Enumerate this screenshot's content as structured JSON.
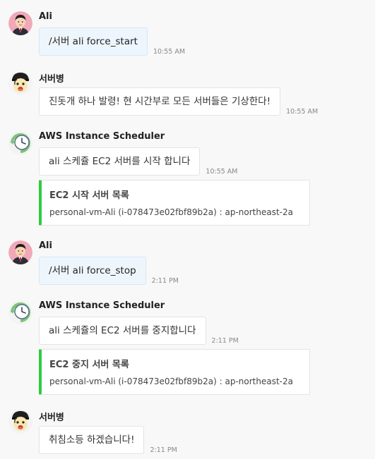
{
  "colors": {
    "background": "#f8f8f8",
    "user_bubble": "#eef6fd",
    "bot_bubble": "#ffffff",
    "attachment_accent": "#2ecc40"
  },
  "messages": [
    {
      "sender": "Ali",
      "avatar": "ali-avatar",
      "text": "/서버 ali force_start",
      "time": "10:55 AM"
    },
    {
      "sender": "서버병",
      "avatar": "soldier-avatar",
      "text": "진돗개 하나 발령! 현 시간부로 모든 서버들은 기상한다!",
      "time": "10:55 AM"
    },
    {
      "sender": "AWS Instance Scheduler",
      "avatar": "clock-avatar",
      "text": "ali 스케쥴 EC2 서버를 시작 합니다",
      "time": "10:55 AM",
      "attachment": {
        "title": "EC2 시작 서버 목록",
        "body": "personal-vm-Ali (i-078473e02fbf89b2a) : ap-northeast-2a"
      }
    },
    {
      "sender": "Ali",
      "avatar": "ali-avatar",
      "text": "/서버 ali force_stop",
      "time": "2:11 PM"
    },
    {
      "sender": "AWS Instance Scheduler",
      "avatar": "clock-avatar",
      "text": "ali 스케쥴의 EC2 서버를 중지합니다",
      "time": "2:11 PM",
      "attachment": {
        "title": "EC2 중지 서버 목록",
        "body": "personal-vm-Ali (i-078473e02fbf89b2a) : ap-northeast-2a"
      }
    },
    {
      "sender": "서버병",
      "avatar": "soldier-avatar",
      "text": "취침소등 하겠습니다!",
      "time": "2:11 PM"
    }
  ]
}
